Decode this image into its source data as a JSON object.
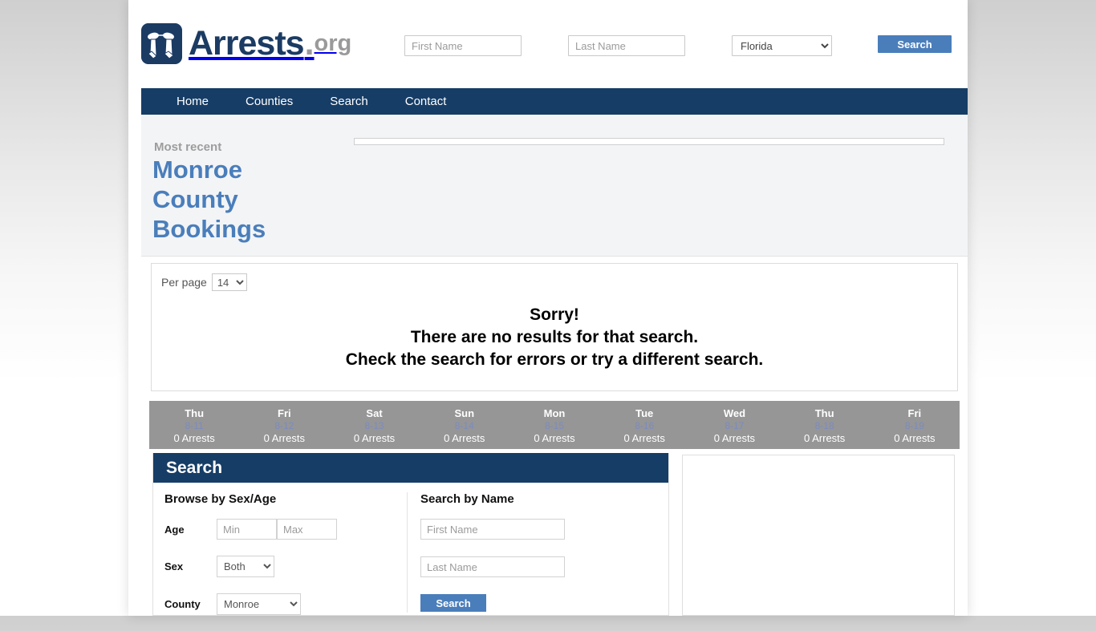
{
  "site": {
    "brand_name": "Arrests",
    "brand_dot": ".",
    "brand_tld": "org",
    "logo_icon": "handcuffs-icon"
  },
  "header": {
    "first_name_placeholder": "First Name",
    "first_name_value": "",
    "last_name_placeholder": "Last Name",
    "last_name_value": "",
    "state_selected": "Florida",
    "state_options": [
      "Florida"
    ],
    "search_label": "Search"
  },
  "nav": {
    "items": [
      {
        "label": "Home"
      },
      {
        "label": "Counties"
      },
      {
        "label": "Search"
      },
      {
        "label": "Contact"
      }
    ]
  },
  "hero": {
    "eyebrow": "Most recent",
    "title": "Monroe County Bookings"
  },
  "results": {
    "per_page_label": "Per page",
    "per_page_selected": "14",
    "per_page_options": [
      "14"
    ],
    "message_line1": "Sorry!",
    "message_line2": "There are no results for that search.",
    "message_line3": "Check the search for errors or try a different search."
  },
  "date_strip": {
    "days": [
      {
        "dow": "Thu",
        "date": "8-11",
        "count": "0 Arrests"
      },
      {
        "dow": "Fri",
        "date": "8-12",
        "count": "0 Arrests"
      },
      {
        "dow": "Sat",
        "date": "8-13",
        "count": "0 Arrests"
      },
      {
        "dow": "Sun",
        "date": "8-14",
        "count": "0 Arrests"
      },
      {
        "dow": "Mon",
        "date": "8-15",
        "count": "0 Arrests"
      },
      {
        "dow": "Tue",
        "date": "8-16",
        "count": "0 Arrests"
      },
      {
        "dow": "Wed",
        "date": "8-17",
        "count": "0 Arrests"
      },
      {
        "dow": "Thu",
        "date": "8-18",
        "count": "0 Arrests"
      },
      {
        "dow": "Fri",
        "date": "8-19",
        "count": "0 Arrests"
      }
    ]
  },
  "search_card": {
    "title": "Search",
    "browse_heading": "Browse by Sex/Age",
    "age_label": "Age",
    "age_min_placeholder": "Min",
    "age_min_value": "",
    "age_max_placeholder": "Max",
    "age_max_value": "",
    "sex_label": "Sex",
    "sex_selected": "Both",
    "sex_options": [
      "Both"
    ],
    "county_label": "County",
    "county_selected": "Monroe",
    "county_options": [
      "Monroe"
    ],
    "name_heading": "Search by Name",
    "first_name_placeholder": "First Name",
    "first_name_value": "",
    "last_name_placeholder": "Last Name",
    "last_name_value": "",
    "name_search_label": "Search"
  },
  "colors": {
    "navy": "#163d66",
    "blue": "#4a7ebb",
    "strip_gray": "#969696",
    "hero_bg": "#f3f4f6"
  }
}
